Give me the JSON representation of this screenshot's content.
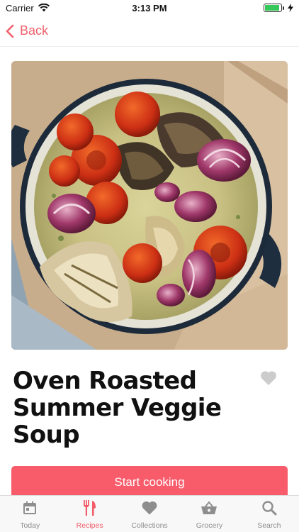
{
  "status_bar": {
    "carrier": "Carrier",
    "time": "3:13 PM",
    "battery_level": 0.9
  },
  "nav": {
    "back_label": "Back",
    "accent_color": "#f0606b"
  },
  "recipe": {
    "title": "Oven Roasted Summer Veggie Soup",
    "favorite": false
  },
  "start_button": {
    "label": "Start cooking",
    "color": "#f85c6b"
  },
  "tabs": [
    {
      "label": "Today",
      "icon": "calendar-icon",
      "active": false
    },
    {
      "label": "Recipes",
      "icon": "fork-knife-icon",
      "active": true
    },
    {
      "label": "Collections",
      "icon": "heart-icon",
      "active": false
    },
    {
      "label": "Grocery",
      "icon": "basket-icon",
      "active": false
    },
    {
      "label": "Search",
      "icon": "search-icon",
      "active": false
    }
  ]
}
